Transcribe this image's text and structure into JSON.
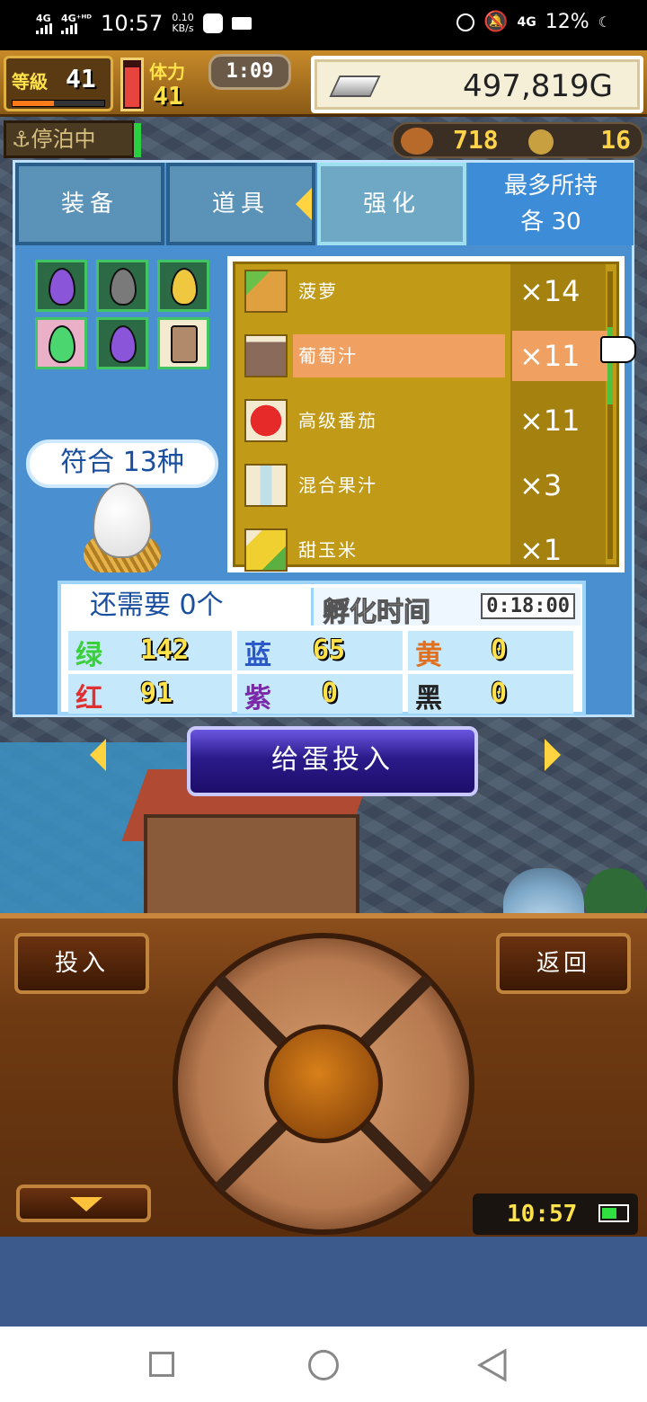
{
  "status_bar": {
    "sim1": "4G",
    "sim2": "4G⁺ᴴᴰ",
    "time": "10:57",
    "net_speed_value": "0.10",
    "net_speed_unit": "KB/s",
    "sim_4g": "4G",
    "battery": "12%"
  },
  "header": {
    "level_label": "等級",
    "level_value": "41",
    "xp_fraction": 0.45,
    "hp_fraction": 0.85,
    "stamina_label": "体力",
    "stamina_value": "41",
    "timer": "1:09",
    "gold": "497,819G",
    "docked": "停泊中",
    "resource_1": "718",
    "resource_2": "16"
  },
  "tabs": [
    {
      "label": "装备",
      "selected": false
    },
    {
      "label": "道具",
      "selected": false
    },
    {
      "label": "强化",
      "selected": true
    }
  ],
  "max_hold": {
    "line1": "最多所持",
    "line2": "各 30"
  },
  "eggs": [
    "purple-egg",
    "gray-egg",
    "yellow-egg",
    "green-egg",
    "purple-egg",
    "mug-item"
  ],
  "match_text": "符合 13种",
  "items": [
    {
      "name": "菠萝",
      "qty": "×14",
      "icon": "pineapple-icon",
      "selected": false
    },
    {
      "name": "葡萄汁",
      "qty": "×11",
      "icon": "grape-juice-icon",
      "selected": true
    },
    {
      "name": "高级番茄",
      "qty": "×11",
      "icon": "tomato-icon",
      "selected": false
    },
    {
      "name": "混合果汁",
      "qty": "×3",
      "icon": "mixed-juice-icon",
      "selected": false
    },
    {
      "name": "甜玉米",
      "qty": "×1",
      "icon": "corn-icon",
      "selected": false
    }
  ],
  "need_text": "还需要 0个",
  "hatch_label": "孵化时间",
  "hatch_time": "0:18:00",
  "stats": [
    {
      "name": "绿",
      "value": "142",
      "color": "#3ccf3c"
    },
    {
      "name": "蓝",
      "value": "65",
      "color": "#2a58c8"
    },
    {
      "name": "黄",
      "value": "0",
      "color": "#e07020"
    },
    {
      "name": "红",
      "value": "91",
      "color": "#e03030"
    },
    {
      "name": "紫",
      "value": "0",
      "color": "#7a2aa8"
    },
    {
      "name": "黑",
      "value": "0",
      "color": "#222222"
    }
  ],
  "give_button": "给蛋投入",
  "controller": {
    "left_button": "投入",
    "right_button": "返回",
    "game_clock": "10:57",
    "battery_fraction": 0.6
  }
}
